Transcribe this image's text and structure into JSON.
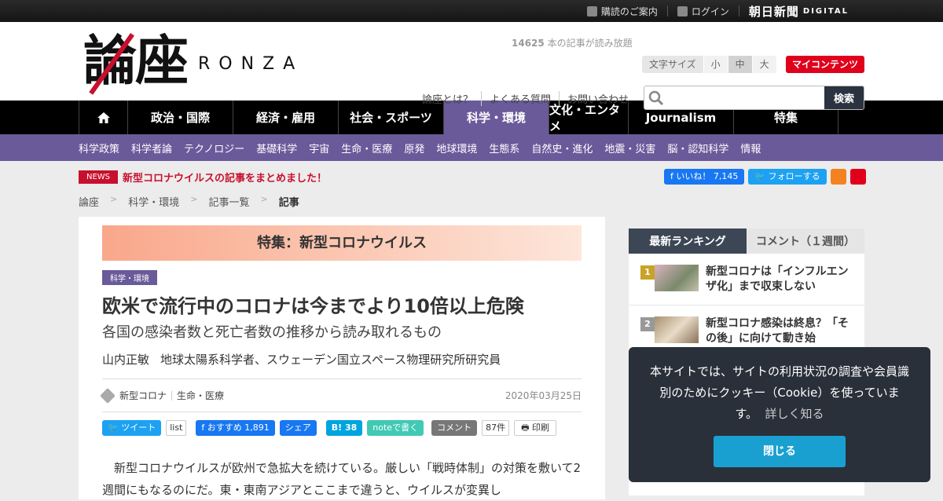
{
  "topbar": {
    "subscribe": "購読のご案内",
    "login": "ログイン",
    "asahi": "朝日新聞",
    "digital": "DIGITAL"
  },
  "logo": {
    "kanji": "論座",
    "roman": "RONZA"
  },
  "header": {
    "article_count": "14625",
    "article_count_suffix": "本の記事が読み放題",
    "fontsize_label": "文字サイズ",
    "fontsize_options": [
      "小",
      "中",
      "大"
    ],
    "fontsize_selected": "中",
    "mycontents": "マイコンテンツ",
    "links": [
      "論座とは？",
      "よくある質問",
      "お問い合わせ"
    ],
    "search_button": "検索"
  },
  "gnav": [
    "政治・国際",
    "経済・雇用",
    "社会・スポーツ",
    "科学・環境",
    "文化・エンタメ",
    "Journalism",
    "特集"
  ],
  "gnav_active": "科学・環境",
  "subnav": [
    "科学政策",
    "科学者論",
    "テクノロジー",
    "基礎科学",
    "宇宙",
    "生命・医療",
    "原発",
    "地球環境",
    "生態系",
    "自然史・進化",
    "地震・災害",
    "脳・認知科学",
    "情報"
  ],
  "news": {
    "tag": "NEWS",
    "text": "新型コロナウイルスの記事をまとめました！"
  },
  "social": {
    "fb_label": "いいね！",
    "fb_count": "7,145",
    "tw_label": "フォローする"
  },
  "breadcrumb": [
    "論座",
    "科学・環境",
    "記事一覧",
    "記事"
  ],
  "article": {
    "feature": "特集：新型コロナウイルス",
    "category": "科学・環境",
    "title": "欧米で流行中のコロナは今までより10倍以上危険",
    "subtitle": "各国の感染者数と死亡者数の推移から読み取れるもの",
    "author": "山内正敏",
    "author_role": "地球太陽系科学者、スウェーデン国立スペース物理研究所研究員",
    "tags": [
      "新型コロナ",
      "生命・医療"
    ],
    "date": "2020年03月25日",
    "share": {
      "tweet": "ツイート",
      "list": "list",
      "fb_recommend": "おすすめ",
      "fb_count": "1,891",
      "share": "シェア",
      "hatena": "B!",
      "hatena_count": "38",
      "note": "noteで書く",
      "comment": "コメント",
      "comment_count": "87件",
      "print": "印刷"
    },
    "body": "新型コロナウイルスが欧州で急拡大を続けている。厳しい「戦時体制」の対策を敷いて2週間にもなるのにだ。東・東南アジアとここまで違うと、ウイルスが変異し"
  },
  "sidebar": {
    "tab_ranking": "最新ランキング",
    "tab_comment": "コメント（１週間）",
    "items": [
      {
        "rank": "1",
        "title": "新型コロナは「インフルエンザ化」まで収束しない",
        "badge_color": "#c9a227"
      },
      {
        "rank": "2",
        "title": "新型コロナ感染は終息？「その後」に向けて動き始",
        "badge_color": "#999999"
      }
    ]
  },
  "cookie": {
    "message": "本サイトでは、サイトの利用状況の調査や会員識別のためにクッキー（Cookie）を使っています。",
    "more": "詳しく知る",
    "close": "閉じる"
  },
  "colors": {
    "accent": "#6b5a9a",
    "red": "#c8102e",
    "dark": "#293039"
  }
}
